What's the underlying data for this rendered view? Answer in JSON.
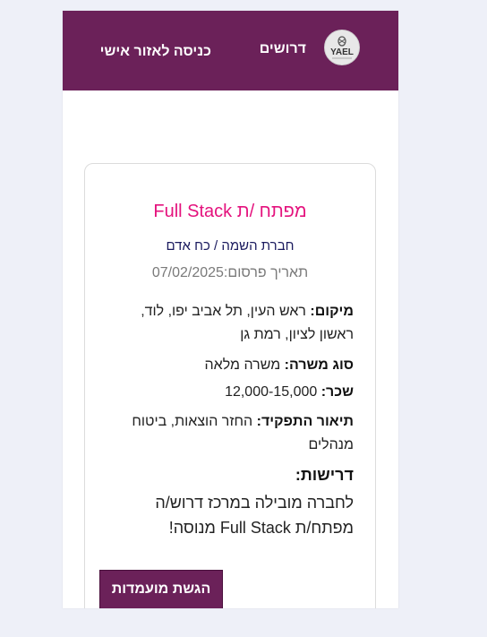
{
  "header": {
    "logo_text": "YAEL",
    "brand_label": "דרושים",
    "login_label": "כניסה לאזור אישי"
  },
  "job": {
    "title": "מפתח /ת Full Stack",
    "company": "חברת השמה / כח אדם",
    "posted_date": "תאריך פרסום:07/02/2025",
    "location_label": "מיקום:",
    "location_value": "ראש העין, תל אביב יפו, לוד, ראשון לציון, רמת גן",
    "job_type_label": "סוג משרה:",
    "job_type_value": "משרה מלאה",
    "salary_label": "שכר:",
    "salary_value": "12,000-15,000",
    "description_label": "תיאור התפקיד:",
    "description_value": "החזר הוצאות, ביטוח מנהלים",
    "requirements_label": "דרישות:",
    "requirements_value": "לחברה מובילה במרכז דרוש/ה מפתח/ת Full Stack מנוסה!"
  },
  "actions": {
    "submit_label": "הגשת מועמדות"
  },
  "colors": {
    "primary": "#6b2159",
    "title": "#e4127d",
    "company": "#1a1a5e",
    "muted": "#7a7a7a",
    "page_background": "#eef0f8"
  }
}
